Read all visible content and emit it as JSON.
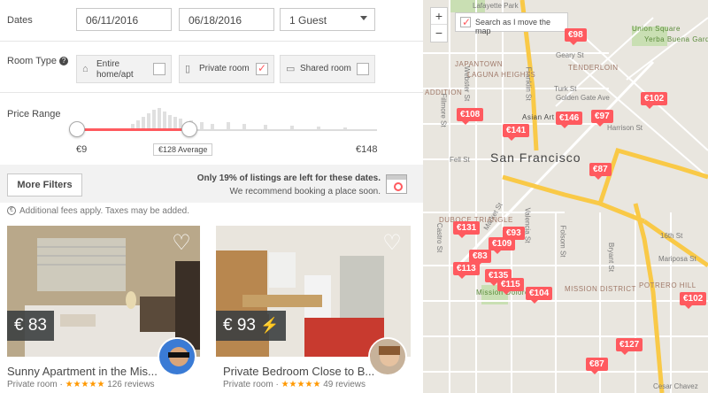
{
  "filters": {
    "dates_label": "Dates",
    "checkin": "06/11/2016",
    "checkout": "06/18/2016",
    "guests": "1 Guest",
    "room_type_label": "Room Type",
    "room_types": [
      {
        "label": "Entire home/apt",
        "checked": false
      },
      {
        "label": "Private room",
        "checked": true
      },
      {
        "label": "Shared room",
        "checked": false
      }
    ],
    "price_range_label": "Price Range",
    "price_min": "€9",
    "price_avg": "€128 Average",
    "price_max": "€148",
    "more_filters": "More Filters",
    "scarcity_title": "Only 19% of listings are left for these dates.",
    "scarcity_sub": "We recommend booking a place soon.",
    "fees_note": "Additional fees apply. Taxes may be added."
  },
  "listings": [
    {
      "price": "€ 83",
      "title": "Sunny Apartment in the Mis...",
      "type": "Private room",
      "stars": "★★★★★",
      "reviews": "126 reviews",
      "instant": false
    },
    {
      "price": "€ 93",
      "title": "Private Bedroom Close to B...",
      "type": "Private room",
      "stars": "★★★★★",
      "reviews": "49 reviews",
      "instant": true
    }
  ],
  "map": {
    "search_move_label": "Search as I move the map",
    "search_move_checked": true,
    "zoom_in": "+",
    "zoom_out": "−",
    "city_label": "San Francisco",
    "pins": [
      "€98",
      "€102",
      "€108",
      "€146",
      "€97",
      "€141",
      "€87",
      "€131",
      "€93",
      "€109",
      "€83",
      "€113",
      "€135",
      "€115",
      "€104",
      "€127",
      "€87",
      "€102"
    ],
    "neighborhoods": [
      "JAPANTOWN",
      "LAGUNA HEIGHTS",
      "ADDITION",
      "TENDERLOIN",
      "DUBOCE TRIANGLE",
      "MISSION DISTRICT",
      "Mission Dolores Park",
      "POTRERO HILL",
      "Union Square",
      "Yerba Buena Gardens",
      "Asian Art M"
    ],
    "streets": [
      "Lafayette Park",
      "Geary St",
      "Turk St",
      "Golden Gate Ave",
      "Fell St",
      "Market St",
      "Folsom St",
      "16th St",
      "Mariposa St",
      "Castro St",
      "Valencia St",
      "Bryant St",
      "Harrison St",
      "Franklin St",
      "Webster St",
      "Fillmore St",
      "Cesar Chavez"
    ]
  },
  "colors": {
    "accent": "#ff5a5f",
    "map_bg": "#e9e6df",
    "highway": "#f9c947"
  }
}
